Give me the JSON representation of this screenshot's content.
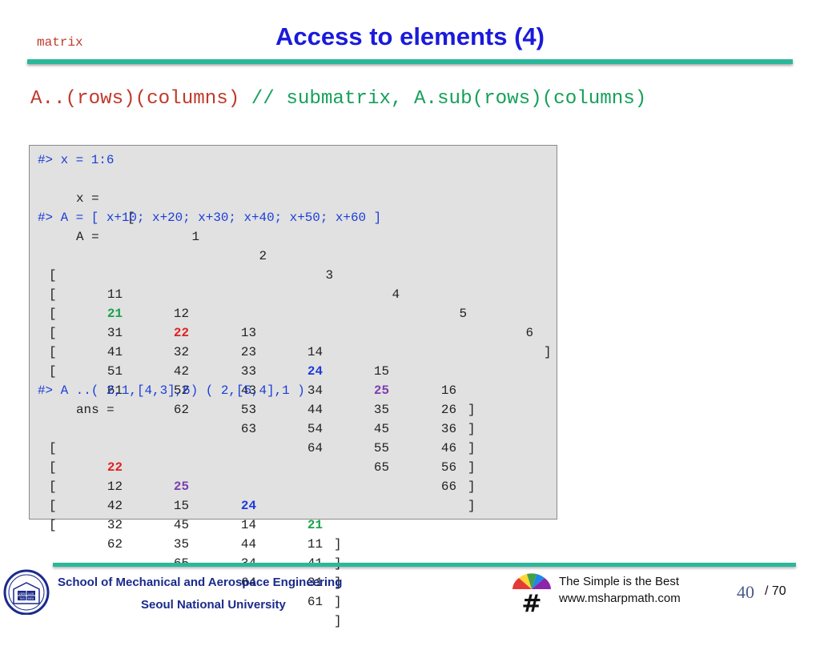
{
  "header": {
    "tag": "matrix",
    "title": "Access to elements (4)"
  },
  "subtitle": {
    "syntax": "A..(rows)(columns)",
    "comment": "// submatrix, A.sub(rows)(columns)"
  },
  "code": {
    "cmd1": "#> x = 1:6",
    "x_label": "x =",
    "x_open": "[",
    "x_close": "]",
    "x_values": [
      "1",
      "2",
      "3",
      "4",
      "5",
      "6"
    ],
    "cmd2": "#> A = [ x+10; x+20; x+30; x+40; x+50; x+60 ]",
    "a_label": "A =",
    "a_rows": [
      [
        "11",
        "12",
        "13",
        "14",
        "15",
        "16"
      ],
      [
        "21",
        "22",
        "23",
        "24",
        "25",
        "26"
      ],
      [
        "31",
        "32",
        "33",
        "34",
        "35",
        "36"
      ],
      [
        "41",
        "42",
        "43",
        "44",
        "45",
        "46"
      ],
      [
        "51",
        "52",
        "53",
        "54",
        "55",
        "56"
      ],
      [
        "61",
        "62",
        "63",
        "64",
        "65",
        "66"
      ]
    ],
    "cmd3": "#> A ..( 2,1,[4,3],6) ( 2,[5,4],1 )",
    "ans_label": "ans =",
    "ans_rows": [
      [
        "22",
        "25",
        "24",
        "21"
      ],
      [
        "12",
        "15",
        "14",
        "11"
      ],
      [
        "42",
        "45",
        "44",
        "41"
      ],
      [
        "32",
        "35",
        "34",
        "31"
      ],
      [
        "62",
        "65",
        "64",
        "61"
      ]
    ],
    "open_bracket": "[",
    "close_bracket": "]",
    "highlight_colors": {
      "green": "#16a34a",
      "red": "#e02020",
      "blue": "#1d3ad8",
      "purple": "#7d3db0"
    }
  },
  "footer": {
    "school": "School of Mechanical and Aerospace Engineering",
    "university": "Seoul National University",
    "logo_text": [
      "VERI",
      "LUX",
      "TAS",
      "MEA"
    ],
    "msharp_symbol": "#",
    "motto_line1": "The Simple is the Best",
    "motto_line2": "www.msharpmath.com",
    "page": "40",
    "total": "/ 70"
  }
}
